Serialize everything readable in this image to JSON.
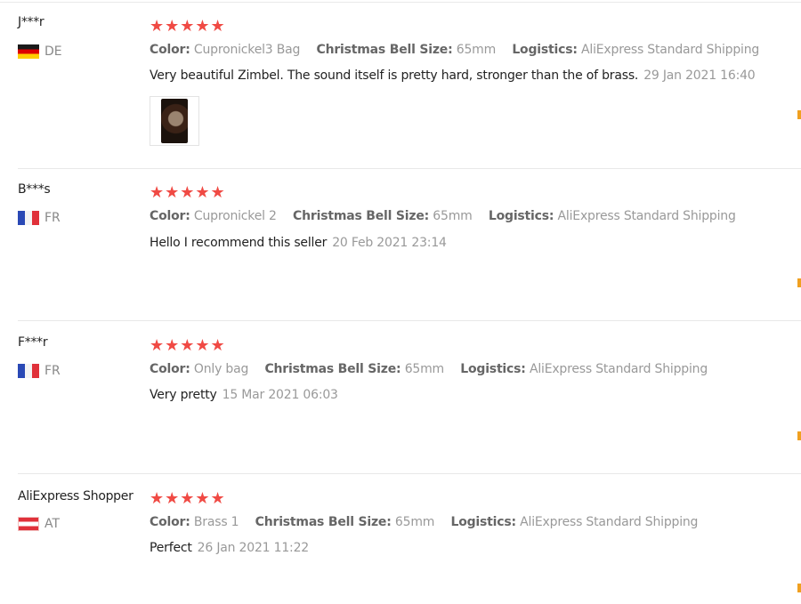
{
  "reviews": [
    {
      "user": "J***r",
      "country_code": "DE",
      "stars": "★★★★★",
      "color_label": "Color:",
      "color_value": "Cupronickel3 Bag",
      "size_label": "Christmas Bell Size:",
      "size_value": "65mm",
      "logistics_label": "Logistics:",
      "logistics_value": "AliExpress Standard Shipping",
      "text": "Very beautiful Zimbel. The sound itself is pretty hard, stronger than the of brass.",
      "date": "29 Jan 2021 16:40"
    },
    {
      "user": "B***s",
      "country_code": "FR",
      "stars": "★★★★★",
      "color_label": "Color:",
      "color_value": "Cupronickel 2",
      "size_label": "Christmas Bell Size:",
      "size_value": "65mm",
      "logistics_label": "Logistics:",
      "logistics_value": "AliExpress Standard Shipping",
      "text": "Hello I recommend this seller",
      "date": "20 Feb 2021 23:14"
    },
    {
      "user": "F***r",
      "country_code": "FR",
      "stars": "★★★★★",
      "color_label": "Color:",
      "color_value": "Only bag",
      "size_label": "Christmas Bell Size:",
      "size_value": "65mm",
      "logistics_label": "Logistics:",
      "logistics_value": "AliExpress Standard Shipping",
      "text": "Very pretty",
      "date": "15 Mar 2021 06:03"
    },
    {
      "user": "AliExpress Shopper",
      "country_code": "AT",
      "stars": "★★★★★",
      "color_label": "Color:",
      "color_value": "Brass 1",
      "size_label": "Christmas Bell Size:",
      "size_value": "65mm",
      "logistics_label": "Logistics:",
      "logistics_value": "AliExpress Standard Shipping",
      "text": "Perfect",
      "date": "26 Jan 2021 11:22"
    }
  ],
  "ratings": [
    5,
    5,
    5,
    5
  ],
  "colors": {
    "star": "#f04a44",
    "marker": "#f0a020",
    "divider": "#e8e8e8"
  },
  "icons": {
    "flags": [
      "germany-flag-icon",
      "france-flag-icon",
      "france-flag-icon",
      "austria-flag-icon"
    ],
    "photo": "review-photo-thumbnail"
  }
}
